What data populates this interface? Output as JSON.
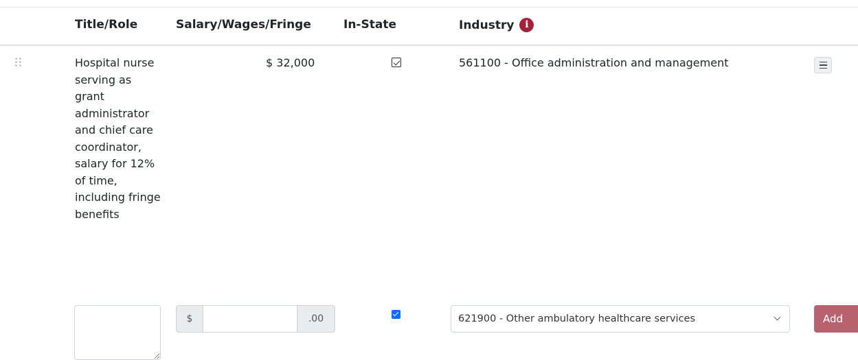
{
  "table": {
    "headers": {
      "title_role": "Title/Role",
      "salary": "Salary/Wages/Fringe",
      "in_state": "In-State",
      "industry": "Industry"
    },
    "info_icon": "info-circle-icon",
    "rows": [
      {
        "title_role": "Hospital nurse serving as grant administrator and chief care coordinator, salary for 12% of time, including fringe benefits",
        "salary": "$ 32,000",
        "in_state": true,
        "industry": "561100 - Office administration and management"
      }
    ]
  },
  "new_row": {
    "title_value": "",
    "currency_prefix": "$",
    "cents_suffix": ".00",
    "salary_value": "",
    "in_state_checked": true,
    "industry_selected": "621900 - Other ambulatory healthcare services",
    "add_label": "Add"
  },
  "colors": {
    "accent": "#a3223a",
    "add_button": "#b9626f",
    "checkbox": "#0d6efd"
  }
}
